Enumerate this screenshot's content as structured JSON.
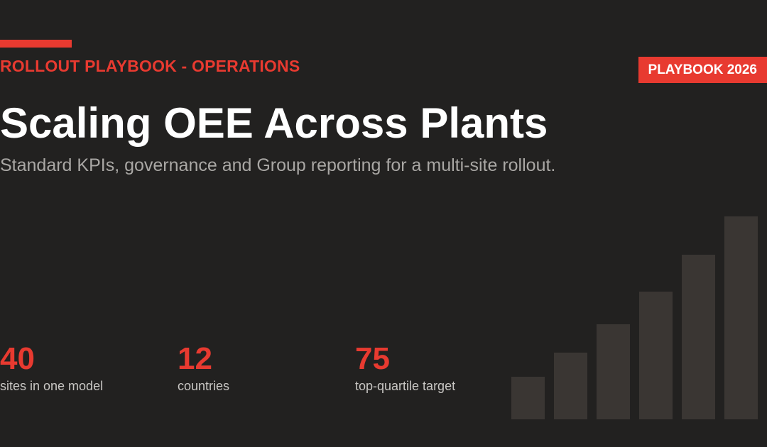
{
  "eyebrow": "ROLLOUT PLAYBOOK - OPERATIONS",
  "badge": "PLAYBOOK 2026",
  "title": "Scaling OEE Across Plants",
  "subtitle": "Standard KPIs, governance and Group reporting for a multi-site rollout.",
  "stats": [
    {
      "value": "40",
      "label": "sites in one model"
    },
    {
      "value": "12",
      "label": "countries"
    },
    {
      "value": "75",
      "label": "top-quartile target"
    }
  ],
  "decor_bars": {
    "levels": [
      0.21,
      0.33,
      0.47,
      0.63,
      0.81,
      1.0
    ],
    "color": "#3a3633"
  },
  "colors": {
    "accent": "#e83a30",
    "background": "#222120",
    "title": "#ffffff",
    "subtitle": "#a9a7a4"
  }
}
